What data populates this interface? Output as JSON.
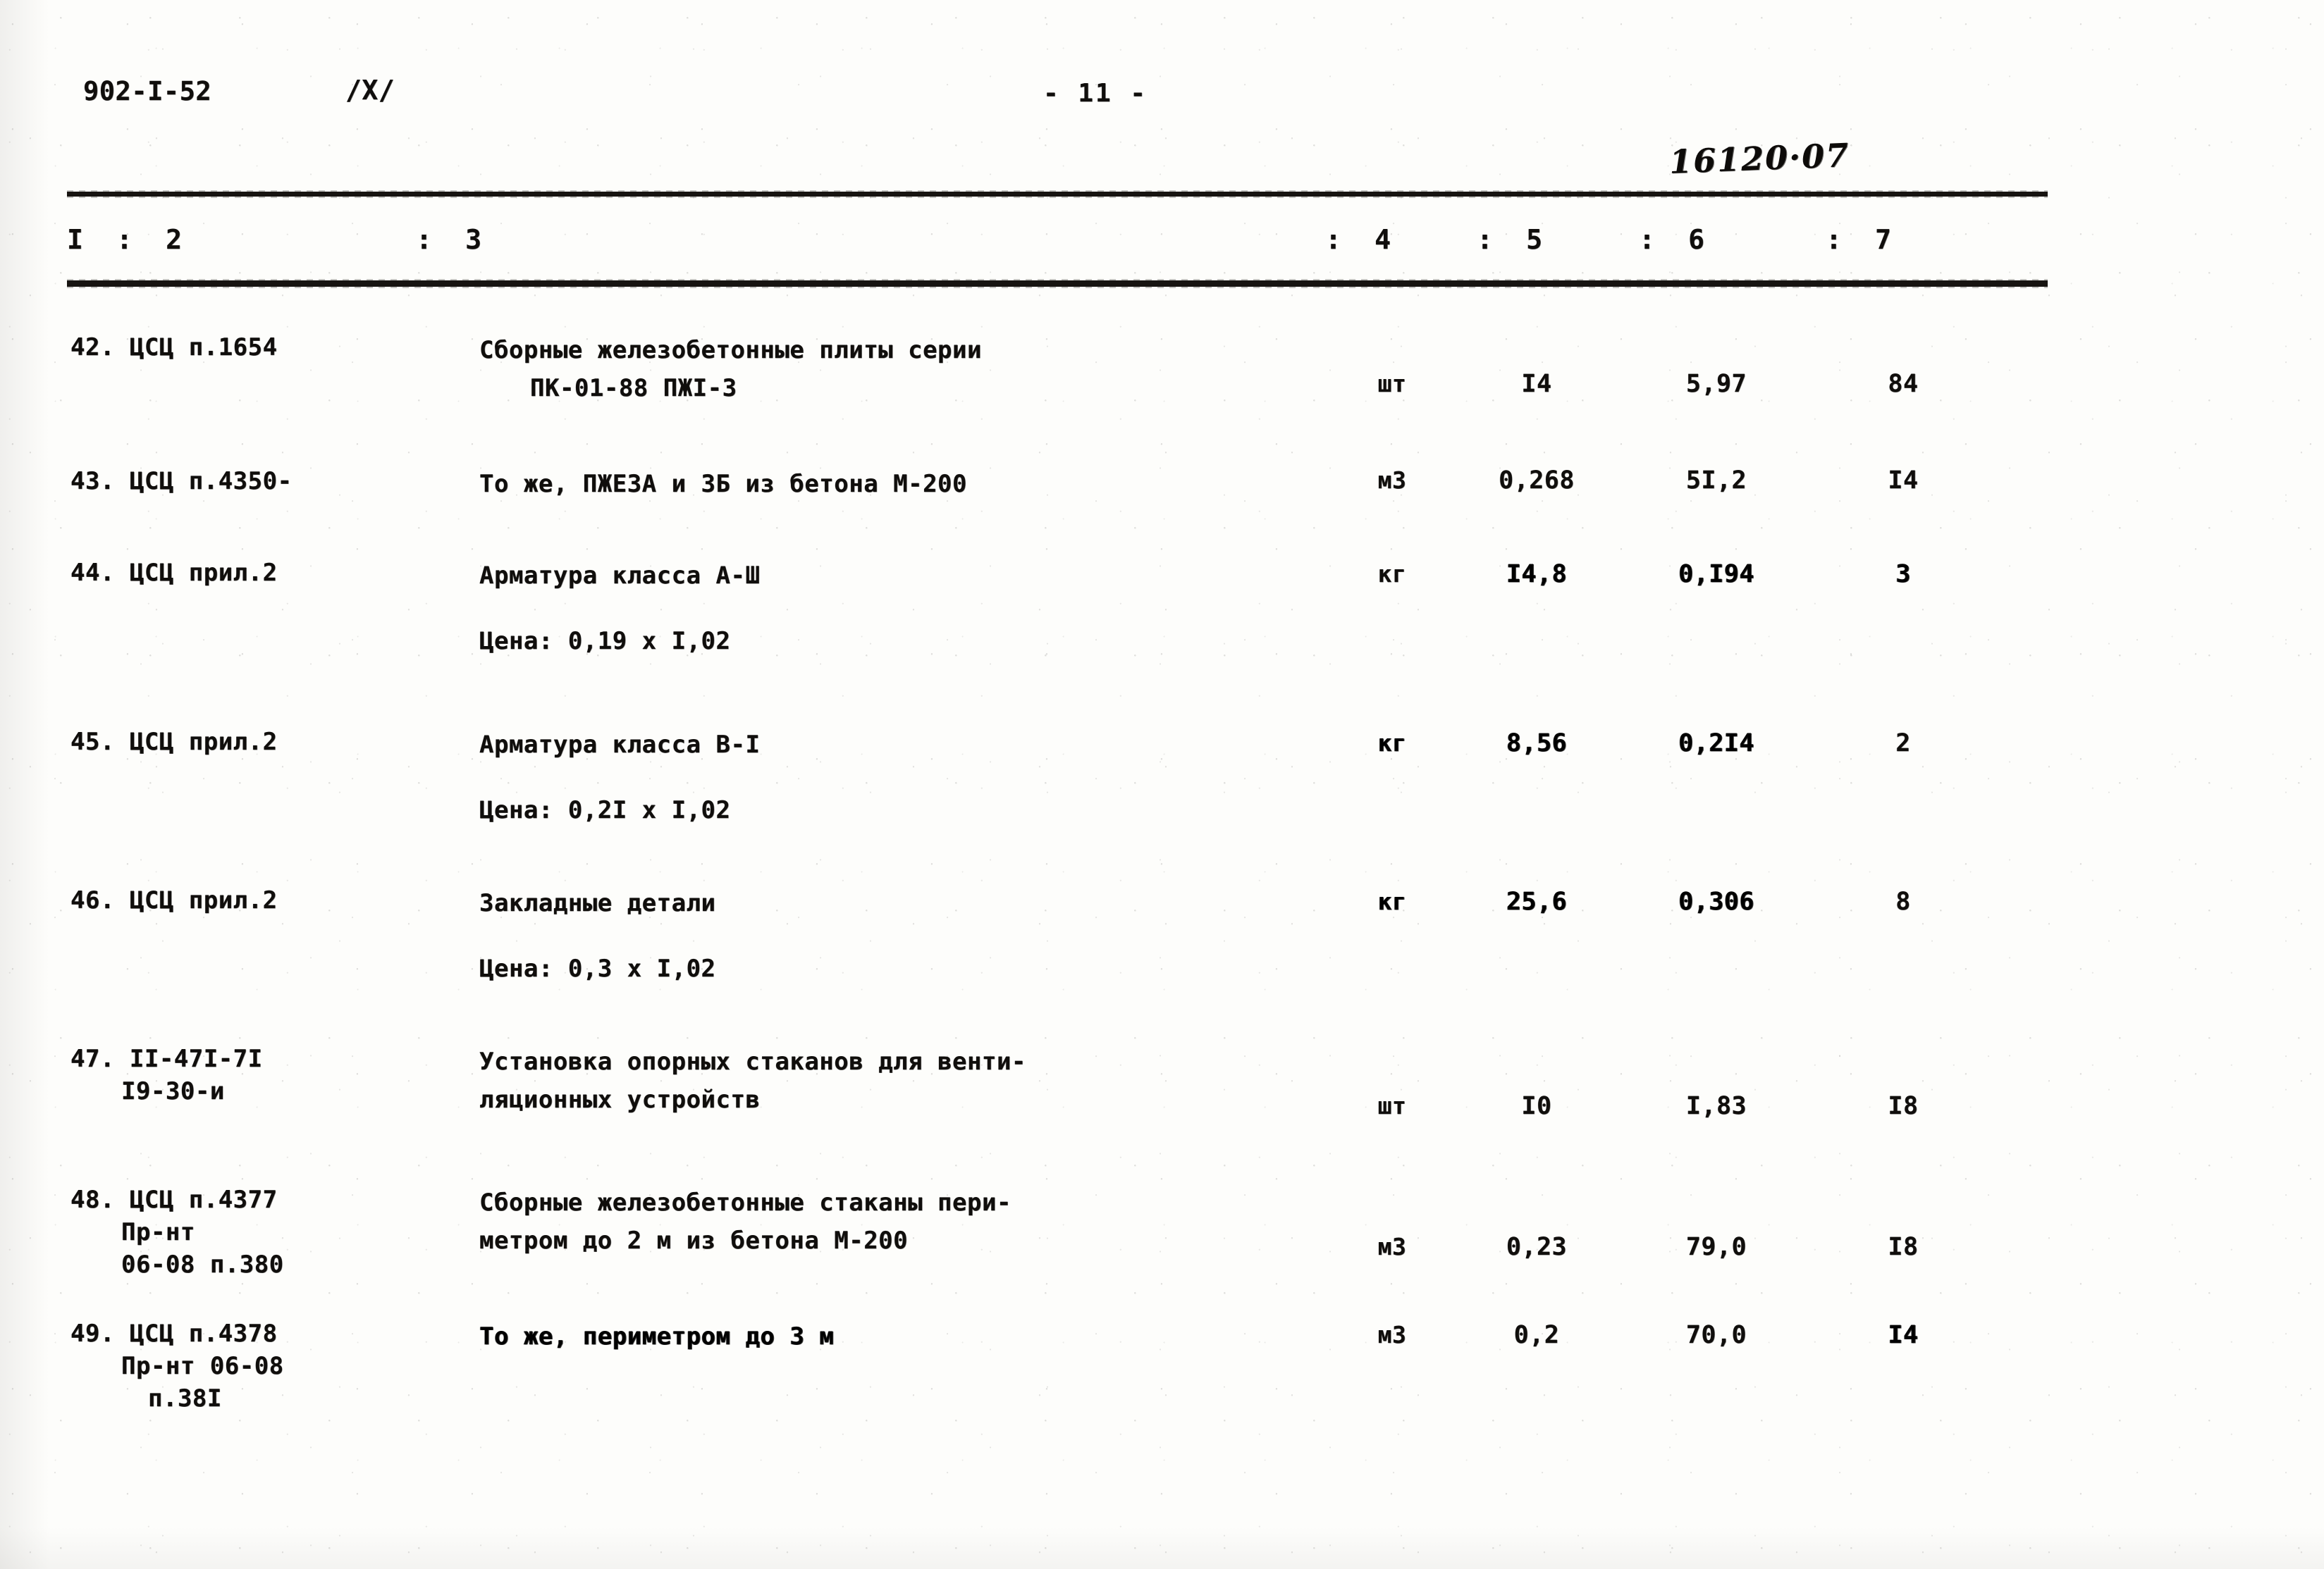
{
  "header": {
    "doc_code": "902-I-52",
    "section": "/X/",
    "page_number": "- 11 -",
    "handwritten_note": "16120·07"
  },
  "table": {
    "column_headers": [
      "I",
      ":  2",
      ":  3",
      ":  4",
      ":  5",
      ":  6",
      ":  7"
    ],
    "rows": [
      {
        "code_lines": [
          "42. ЦСЦ п.1654"
        ],
        "desc_lines": [
          "Сборные железобетонные плиты серии",
          "ПК-01-88 ПЖI-3"
        ],
        "price_note": "",
        "unit": "шт",
        "qty": "I4",
        "cost": "5,97",
        "total": "84"
      },
      {
        "code_lines": [
          "43. ЦСЦ п.4350-"
        ],
        "desc_lines": [
          "То же, ПЖЕ3А и 3Б из бетона М-200"
        ],
        "price_note": "",
        "unit": "м3",
        "qty": "0,268",
        "cost": "5I,2",
        "total": "I4"
      },
      {
        "code_lines": [
          "44. ЦСЦ прил.2"
        ],
        "desc_lines": [
          "Арматура класса А-Ш"
        ],
        "price_note": "Цена: 0,19 х I,02",
        "unit": "кг",
        "qty": "I4,8",
        "cost": "0,I94",
        "total": "3"
      },
      {
        "code_lines": [
          "45. ЦСЦ прил.2"
        ],
        "desc_lines": [
          "Арматура класса В-I"
        ],
        "price_note": "Цена: 0,2I х I,02",
        "unit": "кг",
        "qty": "8,56",
        "cost": "0,2I4",
        "total": "2"
      },
      {
        "code_lines": [
          "46. ЦСЦ прил.2"
        ],
        "desc_lines": [
          "Закладные детали"
        ],
        "price_note": "Цена: 0,3 х I,02",
        "unit": "кг",
        "qty": "25,6",
        "cost": "0,306",
        "total": "8"
      },
      {
        "code_lines": [
          "47. II-47I-7I",
          "I9-30-и"
        ],
        "desc_lines": [
          "Установка опорных стаканов для венти-",
          "ляционных устройств"
        ],
        "price_note": "",
        "unit": "шт",
        "qty": "I0",
        "cost": "I,83",
        "total": "I8"
      },
      {
        "code_lines": [
          "48. ЦСЦ п.4377",
          "Пр-нт",
          "06-08 п.380"
        ],
        "desc_lines": [
          "Сборные железобетонные стаканы пери-",
          "метром до 2 м из бетона М-200"
        ],
        "price_note": "",
        "unit": "м3",
        "qty": "0,23",
        "cost": "79,0",
        "total": "I8"
      },
      {
        "code_lines": [
          "49. ЦСЦ п.4378",
          "Пр-нт 06-08",
          "п.38I"
        ],
        "desc_lines": [
          "То же, периметром до 3 м"
        ],
        "price_note": "",
        "unit": "м3",
        "qty": "0,2",
        "cost": "70,0",
        "total": "I4"
      }
    ]
  }
}
